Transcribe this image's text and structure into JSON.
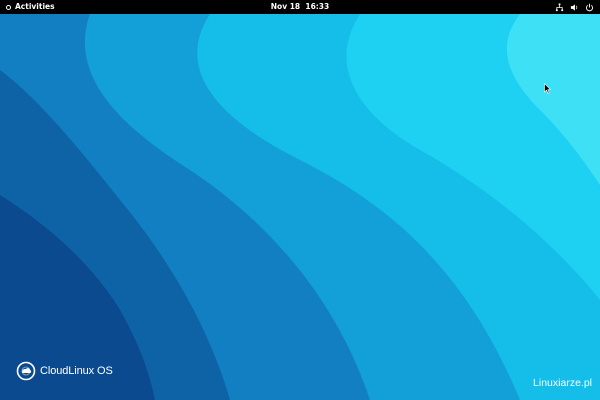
{
  "topbar": {
    "activities_label": "Activities",
    "clock": "Nov 18  16:33",
    "status_icons": [
      "network-icon",
      "volume-icon",
      "power-icon"
    ]
  },
  "desktop": {
    "brand_text": "CloudLinux OS",
    "watermark_text": "Linuxiarze.pl",
    "wallpaper_colors": [
      "#0b3f7f",
      "#1068b0",
      "#1390d0",
      "#14b5e6",
      "#19cdf0",
      "#3ee0f6"
    ]
  }
}
